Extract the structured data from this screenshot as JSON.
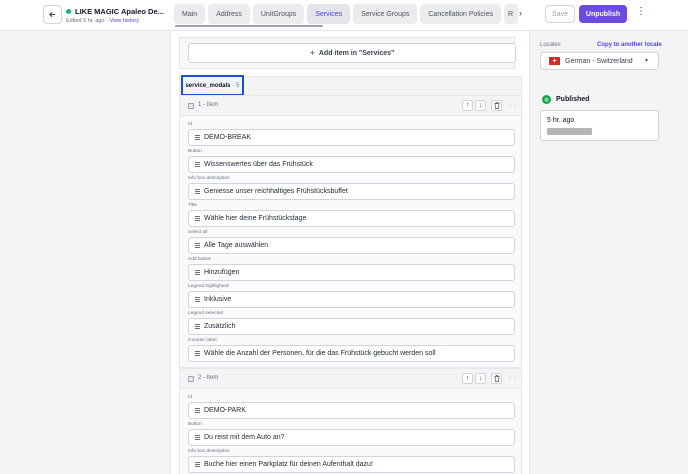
{
  "header": {
    "title": "LIKE MAGIC Apaleo De...",
    "edited": "Edited 5 hr. ago",
    "separator": " · ",
    "history_link": "View history",
    "tabs": [
      {
        "label": "Main"
      },
      {
        "label": "Address"
      },
      {
        "label": "UnitGroups"
      },
      {
        "label": "Services"
      },
      {
        "label": "Service Groups"
      },
      {
        "label": "Cancellation Policies"
      },
      {
        "label": "R"
      }
    ],
    "active_tab": "Services",
    "save_label": "Save",
    "unpublish_label": "Unpublish"
  },
  "editor": {
    "add_item_label": "Add item in \"Services\"",
    "section_name": "service_modals",
    "section_count": "· 5",
    "items": [
      {
        "title": "1 - Item",
        "fields": [
          {
            "label": "Id",
            "value": "DEMO-BREAK"
          },
          {
            "label": "Button",
            "value": "Wissenswertes über das Frühstück"
          },
          {
            "label": "Info box description",
            "value": "Geniesse unser reichhaltiges Frühstücksbuffet"
          },
          {
            "label": "Title",
            "value": "Wähle hier deine Frühstückstage"
          },
          {
            "label": "Select all",
            "value": "Alle Tage auswählen"
          },
          {
            "label": "Add button",
            "value": "Hinzufügen"
          },
          {
            "label": "Legend highlighted",
            "value": "Inklusive"
          },
          {
            "label": "Legend selected",
            "value": "Zusätzlich"
          },
          {
            "label": "Counter label",
            "value": "Wähle die Anzahl der Personen, für die das Frühstück gebucht werden soll"
          }
        ]
      },
      {
        "title": "2 - Item",
        "fields": [
          {
            "label": "Id",
            "value": "DEMO-PARK"
          },
          {
            "label": "Button",
            "value": "Du reist mit dem Auto an?"
          },
          {
            "label": "Info box description",
            "value": "Buche hier einen Parkplatz für deinen Aufenthalt dazu!"
          }
        ]
      }
    ]
  },
  "sidebar": {
    "locales_label": "Locales",
    "copy_locale_label": "Copy to another locale",
    "locale_value": "German - Switzerland",
    "status_label": "Published",
    "published_time": "5 hr. ago"
  },
  "colors": {
    "accent": "#6d4ae0",
    "link": "#4f46e5",
    "published": "#16a34a",
    "highlight_box": "#1d4ed8"
  }
}
